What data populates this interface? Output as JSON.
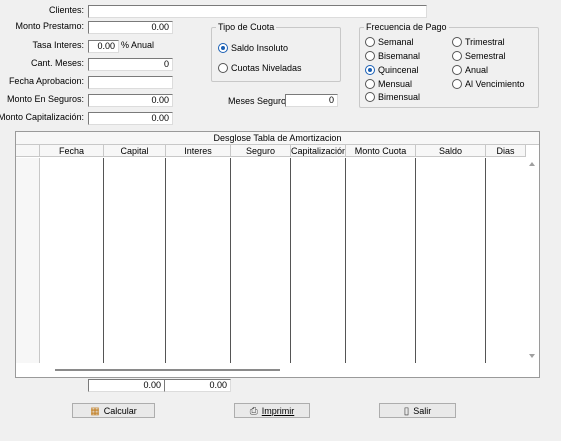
{
  "labels": {
    "clientes": "Clientes:",
    "monto_prestamo": "Monto Prestamo:",
    "tasa_interes": "Tasa Interes:",
    "pct_anual": "% Anual",
    "cant_meses": "Cant. Meses:",
    "fecha_aprobacion": "Fecha Aprobacion:",
    "monto_seguros": "Monto En Seguros:",
    "monto_capitalizacion": "Monto Capitalización:",
    "meses_seguro": "Meses Seguro:"
  },
  "values": {
    "clientes": "",
    "monto_prestamo": "0.00",
    "tasa_interes": "0.00",
    "cant_meses": "0",
    "fecha_aprobacion": "",
    "monto_seguros": "0.00",
    "monto_capitalizacion": "0.00",
    "meses_seguro": "0",
    "total_1": "0.00",
    "total_2": "0.00"
  },
  "tipo_cuota": {
    "title": "Tipo de Cuota",
    "options": [
      "Saldo Insoluto",
      "Cuotas Niveladas"
    ],
    "selected": "Saldo Insoluto"
  },
  "frecuencia": {
    "title": "Frecuencia de Pago",
    "options": [
      "Semanal",
      "Bisemanal",
      "Quincenal",
      "Mensual",
      "Bimensual",
      "Trimestral",
      "Semestral",
      "Anual",
      "Al Vencimiento"
    ],
    "selected": "Quincenal"
  },
  "grid": {
    "title": "Desglose Tabla de Amortizacion",
    "columns": [
      "Fecha",
      "Capital",
      "Interes",
      "Seguro",
      "Capitalización",
      "Monto Cuota",
      "Saldo",
      "Dias"
    ]
  },
  "buttons": {
    "calcular": "Calcular",
    "imprimir": "Imprimir",
    "salir": "Salir"
  }
}
